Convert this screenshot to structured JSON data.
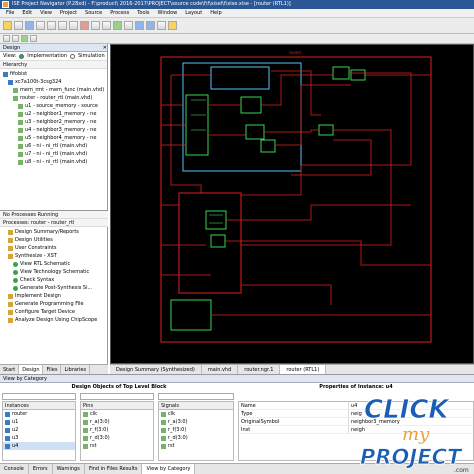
{
  "window": {
    "title": "ISE Project Navigator (P.28xd) - F:\\product\\ 2016-2017\\PROJECT\\source code\\f\\f\\xisel\\f\\xise.xise - [router (RTL1)]"
  },
  "menu": [
    "File",
    "Edit",
    "View",
    "Project",
    "Source",
    "Process",
    "Tools",
    "Window",
    "Layout",
    "Help"
  ],
  "design_panel": {
    "title": "Design",
    "view_label": "View:",
    "view_options": [
      "Implementation",
      "Simulation"
    ],
    "hierarchy_label": "Hierarchy",
    "tree": [
      {
        "label": "fifobist",
        "icon": "chip-icon",
        "indent": 0
      },
      {
        "label": "xc7a100t-3csg324",
        "icon": "chip-icon",
        "indent": 1
      },
      {
        "label": "mem_rmt - mem_func (main.vhd)",
        "icon": "file-icon",
        "indent": 2
      },
      {
        "label": "router - router_rtl (main.vhd)",
        "icon": "file-icon",
        "indent": 2
      },
      {
        "label": "u1 - source_memory - source",
        "icon": "file-icon",
        "indent": 3
      },
      {
        "label": "u2 - neighbor1_memory - ne",
        "icon": "file-icon",
        "indent": 3
      },
      {
        "label": "u3 - neighbor2_memory - ne",
        "icon": "file-icon",
        "indent": 3
      },
      {
        "label": "u4 - neighbor3_memory - ne",
        "icon": "file-icon",
        "indent": 3
      },
      {
        "label": "u5 - neighbor4_memory - ne",
        "icon": "file-icon",
        "indent": 3
      },
      {
        "label": "u6 - ni - ni_rtl (main.vhd)",
        "icon": "file-icon",
        "indent": 3
      },
      {
        "label": "u7 - ni - ni_rtl (main.vhd)",
        "icon": "file-icon",
        "indent": 3
      },
      {
        "label": "u8 - ni - ni_rtl (main.vhd)",
        "icon": "file-icon",
        "indent": 3
      }
    ],
    "no_processes": "No Processes Running",
    "processes_label": "Processes: router - router_rtl",
    "processes": [
      {
        "label": "Design Summary/Reports",
        "indent": 1
      },
      {
        "label": "Design Utilities",
        "indent": 1
      },
      {
        "label": "User Constraints",
        "indent": 1
      },
      {
        "label": "Synthesize - XST",
        "indent": 1
      },
      {
        "label": "View RTL Schematic",
        "indent": 2
      },
      {
        "label": "View Technology Schematic",
        "indent": 2
      },
      {
        "label": "Check Syntax",
        "indent": 2
      },
      {
        "label": "Generate Post-Synthesis Si...",
        "indent": 2
      },
      {
        "label": "Implement Design",
        "indent": 1
      },
      {
        "label": "Generate Programming File",
        "indent": 1
      },
      {
        "label": "Configure Target Device",
        "indent": 1
      },
      {
        "label": "Analyze Design Using ChipScope",
        "indent": 1
      }
    ],
    "bottom_tabs": [
      "Start",
      "Design",
      "Files",
      "Libraries"
    ]
  },
  "doc_tabs": [
    "Design Summary (Synthesized)",
    "main.vhd",
    "router.ngr.1",
    "router (RTL1)"
  ],
  "view_by_category": "View by Category",
  "bottom": {
    "objects_header": "Design Objects of Top Level Block",
    "properties_header": "Properties of Instance: u4",
    "instances": {
      "title": "Instances",
      "rows": [
        "router",
        "u1",
        "u2",
        "u3",
        "u4"
      ]
    },
    "pins": {
      "title": "Pins",
      "rows": [
        "clk",
        "r_a(3:0)",
        "r_f(3:0)",
        "r_d(3:0)",
        "rst"
      ]
    },
    "signals": {
      "title": "Signals",
      "rows": [
        "clk",
        "r_a(3:0)",
        "r_f(3:0)",
        "r_d(3:0)",
        "rst"
      ]
    },
    "properties": [
      {
        "k": "Name",
        "v": "u4"
      },
      {
        "k": "Type",
        "v": "neig"
      },
      {
        "k": "OriginalSymbol",
        "v": "neighbor3_memory"
      },
      {
        "k": "Inst",
        "v": "neigh"
      }
    ],
    "tabs": [
      "Console",
      "Errors",
      "Warnings",
      "Find in Files Results",
      "View by Category"
    ]
  },
  "watermark": {
    "line1": "CLICK",
    "line2": "my",
    "line3": "PROJECT",
    "suffix": ".com"
  },
  "schematic": {
    "top_label": "router"
  },
  "colors": {
    "title_bg": "#2b5797",
    "wire": "#e02020",
    "block_cyan": "#4fc3f7",
    "block_green": "#39d353",
    "canvas": "#000000"
  }
}
